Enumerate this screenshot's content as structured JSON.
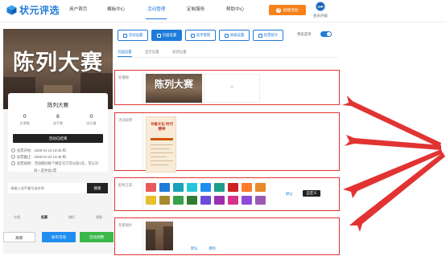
{
  "header": {
    "logo_text": "状元评选",
    "nav": [
      "用户首页",
      "模板中心",
      "活动管理",
      "定制服务",
      "帮助中心"
    ],
    "active_nav": "活动管理",
    "create_button": "创建活动",
    "vip_badge": "VIP",
    "vip_label": "会员升级"
  },
  "preview": {
    "banner_title": "陈列大赛",
    "event_name": "陈列大赛",
    "stats": [
      {
        "value": "0",
        "label": "总票数"
      },
      {
        "value": "6",
        "label": "选手数"
      },
      {
        "value": "0",
        "label": "访问量"
      }
    ],
    "status_button": "活动已结束",
    "start_time": "投票开始：2025-01-16 13:45 和",
    "end_time": "投票截止：2025-01-22 13:45 和",
    "rule_line1": "投票规则：活动期间每个微信号只可以投1次，可以对",
    "rule_line2": "同一选手投1票",
    "search_placeholder": "请输入选手编号或名称",
    "search_button": "搜索",
    "bottom_tabs": [
      "介绍",
      "投票",
      "排行",
      "消息"
    ],
    "active_bottom_tab": "投票"
  },
  "footer": {
    "refresh": "刷新",
    "publish": "发布活动",
    "settings": "活动调整"
  },
  "toolbar": {
    "tabs": [
      "活动设置",
      "页面设置",
      "选手管理",
      "高级设置",
      "投票统计"
    ],
    "active_tab": "页面设置",
    "preview_mode_label": "预览选项",
    "preview_mode_on": true
  },
  "sub_tabs": {
    "items": [
      "页面设置",
      "显示设置",
      "底部设置"
    ],
    "active": "页面设置"
  },
  "sections": {
    "carousel": {
      "label": "轮播图",
      "image_title": "陈列大赛",
      "add_symbol": "+"
    },
    "description": {
      "label": "活动说明",
      "poster_text": "书香文化 时代精神"
    },
    "color_scheme": {
      "label": "配色方案",
      "colors_row1": [
        "#e85a5a",
        "#1f7bd8",
        "#17a2b8",
        "#26c6da",
        "#1f8ef1",
        "#1e9e8a",
        "#cc2222",
        "#ff7a2b",
        "#e8892b"
      ],
      "colors_row2": [
        "#e8c02b",
        "#a78a2b",
        "#36a04a",
        "#2e7d32",
        "#6b4bd8",
        "#9b2fb0",
        "#d6328a",
        "#8e4bd8",
        "#9b59b6"
      ],
      "default_link": "默认",
      "custom_button": "自定义"
    },
    "background": {
      "label": "背景图片",
      "default_link": "默认",
      "clear_link": "清除"
    }
  },
  "colors": {
    "brand_blue": "#1f7bd8",
    "accent_orange": "#f7821b",
    "highlight_red": "#e23333"
  }
}
